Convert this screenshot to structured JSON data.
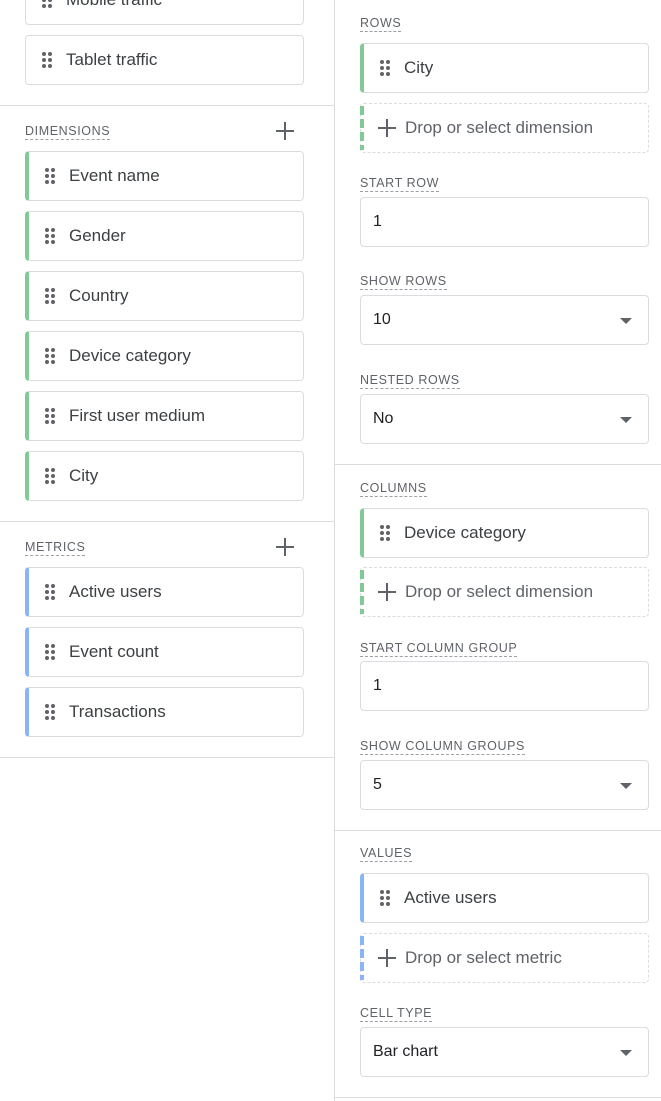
{
  "left": {
    "segments": [
      {
        "label": "Mobile traffic"
      },
      {
        "label": "Tablet traffic"
      }
    ],
    "dimensions": {
      "label": "DIMENSIONS",
      "items": [
        {
          "label": "Event name"
        },
        {
          "label": "Gender"
        },
        {
          "label": "Country"
        },
        {
          "label": "Device category"
        },
        {
          "label": "First user medium"
        },
        {
          "label": "City"
        }
      ]
    },
    "metrics": {
      "label": "METRICS",
      "items": [
        {
          "label": "Active users"
        },
        {
          "label": "Event count"
        },
        {
          "label": "Transactions"
        }
      ]
    }
  },
  "right": {
    "rows": {
      "label": "ROWS",
      "item": "City",
      "drop": "Drop or select dimension"
    },
    "start_row": {
      "label": "START ROW",
      "value": "1"
    },
    "show_rows": {
      "label": "SHOW ROWS",
      "value": "10"
    },
    "nested_rows": {
      "label": "NESTED ROWS",
      "value": "No"
    },
    "columns": {
      "label": "COLUMNS",
      "item": "Device category",
      "drop": "Drop or select dimension"
    },
    "start_column_group": {
      "label": "START COLUMN GROUP",
      "value": "1"
    },
    "show_column_groups": {
      "label": "SHOW COLUMN GROUPS",
      "value": "5"
    },
    "values": {
      "label": "VALUES",
      "item": "Active users",
      "drop": "Drop or select metric"
    },
    "cell_type": {
      "label": "CELL TYPE",
      "value": "Bar chart"
    }
  },
  "colors": {
    "dimension_accent": "#81c995",
    "metric_accent": "#8ab4f8",
    "border": "#dadce0"
  }
}
